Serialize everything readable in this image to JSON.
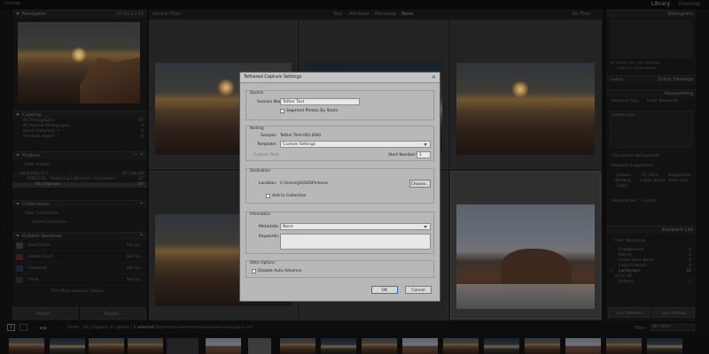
{
  "app": {
    "title": "Lounge"
  },
  "modules": {
    "library": "Library",
    "develop": "Develop"
  },
  "left": {
    "navigator": {
      "title": "Navigator",
      "modes": [
        "FIT",
        "FILL",
        "1:1",
        "3:1"
      ]
    },
    "catalog": {
      "title": "Catalog",
      "items": [
        {
          "label": "All Photographs",
          "count": "87"
        },
        {
          "label": "All Synced Photographs",
          "count": "0"
        },
        {
          "label": "Quick Collection +",
          "count": "0"
        },
        {
          "label": "Previous Import",
          "count": "0"
        }
      ]
    },
    "folders": {
      "title": "Folders",
      "filter": "Filter Folders",
      "disk": "Local Disk (C:)",
      "disk_size": "42 / 64 GB",
      "items": [
        {
          "label": "SPEED 01 - Mastering Lightroom Fundament...",
          "count": "87"
        },
        {
          "label": "00_Originals",
          "count": "87"
        }
      ]
    },
    "collections": {
      "title": "Collections",
      "filter": "Filter Collections",
      "items": [
        {
          "label": "Smart Collections"
        }
      ]
    },
    "publish": {
      "title": "Publish Services",
      "items": [
        {
          "label": "Hard Drive",
          "status": "Set Up..."
        },
        {
          "label": "Adobe Stock",
          "status": "Set Up..."
        },
        {
          "label": "Facebook",
          "status": "Set Up..."
        },
        {
          "label": "Flickr",
          "status": "Set Up..."
        }
      ],
      "find_more": "Find More Services Online..."
    },
    "import_label": "Import...",
    "export_label": "Export..."
  },
  "center": {
    "filter_label": "Library Filter :",
    "filter_tabs": [
      "Text",
      "Attribute",
      "Metadata",
      "None"
    ],
    "filter_off": "No Filter"
  },
  "dialog": {
    "title": "Tethered Capture Settings",
    "session": {
      "section": "Session",
      "name_label": "Session Name:",
      "name_value": "Tether Test",
      "segment_label": "Segment Photos By Shots"
    },
    "naming": {
      "section": "Naming",
      "sample_label": "Sample:",
      "sample_value": "Tether Test-001.DNG",
      "template_label": "Template:",
      "template_value": "Custom Settings",
      "custom_label": "Custom Text:",
      "start_label": "Start Number:",
      "start_value": "1"
    },
    "destination": {
      "section": "Destination",
      "location_label": "Location:",
      "location_value": "C:\\Users\\JGOLD\\Pictures",
      "choose_label": "Choose...",
      "add_label": "Add to Collection"
    },
    "information": {
      "section": "Information",
      "metadata_label": "Metadata:",
      "metadata_value": "None",
      "keywords_label": "Keywords:"
    },
    "other": {
      "section": "Other Options",
      "disable_label": "Disable Auto Advance"
    },
    "ok_label": "OK",
    "cancel_label": "Cancel"
  },
  "right": {
    "histogram": {
      "title": "Histogram",
      "readouts": [
        "ISO 100",
        "21 mm",
        "f / 8.0",
        "1/250 sec"
      ],
      "smart_preview": "Original + Smart Preview"
    },
    "quick_develop": {
      "title": "Quick Develop",
      "preset": "Custom"
    },
    "keywording": {
      "title": "Keywording",
      "tags_label": "Keyword Tags",
      "tags_value": "Enter Keywords",
      "tag": "Landscape",
      "click_add": "Click here to add keywords",
      "suggestions_title": "Keyword Suggestions",
      "suggestions": [
        "Sedona",
        "ST_CRUX...",
        "Engagement",
        "Wedding",
        "Lagoon Beach",
        "Home Shoe",
        "Family"
      ],
      "set_label": "Keyword Set",
      "set_value": "Custom"
    },
    "keyword_list": {
      "title": "Keyword List",
      "filter": "Filter Keywords",
      "items": [
        {
          "label": "Engagement",
          "count": "1"
        },
        {
          "label": "Family",
          "count": "1"
        },
        {
          "label": "Home Shoe Bend",
          "count": "1"
        },
        {
          "label": "Laguna Beach",
          "count": "1"
        },
        {
          "label": "Landscape",
          "count": "22"
        },
        {
          "label": "UFCC RC",
          "count": ""
        },
        {
          "label": "Sedona",
          "count": "1"
        }
      ]
    },
    "sync_label": "Sync Metadata",
    "sync_settings_label": "Sync Settings"
  },
  "filmstrip": {
    "page": "1",
    "path_prefix": "Folder : 00_Originals",
    "photos": "37 photos /",
    "selected": "1 selected",
    "file": "/lightroom-fundamental-tutorials-in-lounge-1.cr2",
    "filter_label": "Filter :",
    "filter_value": "No Filter"
  }
}
